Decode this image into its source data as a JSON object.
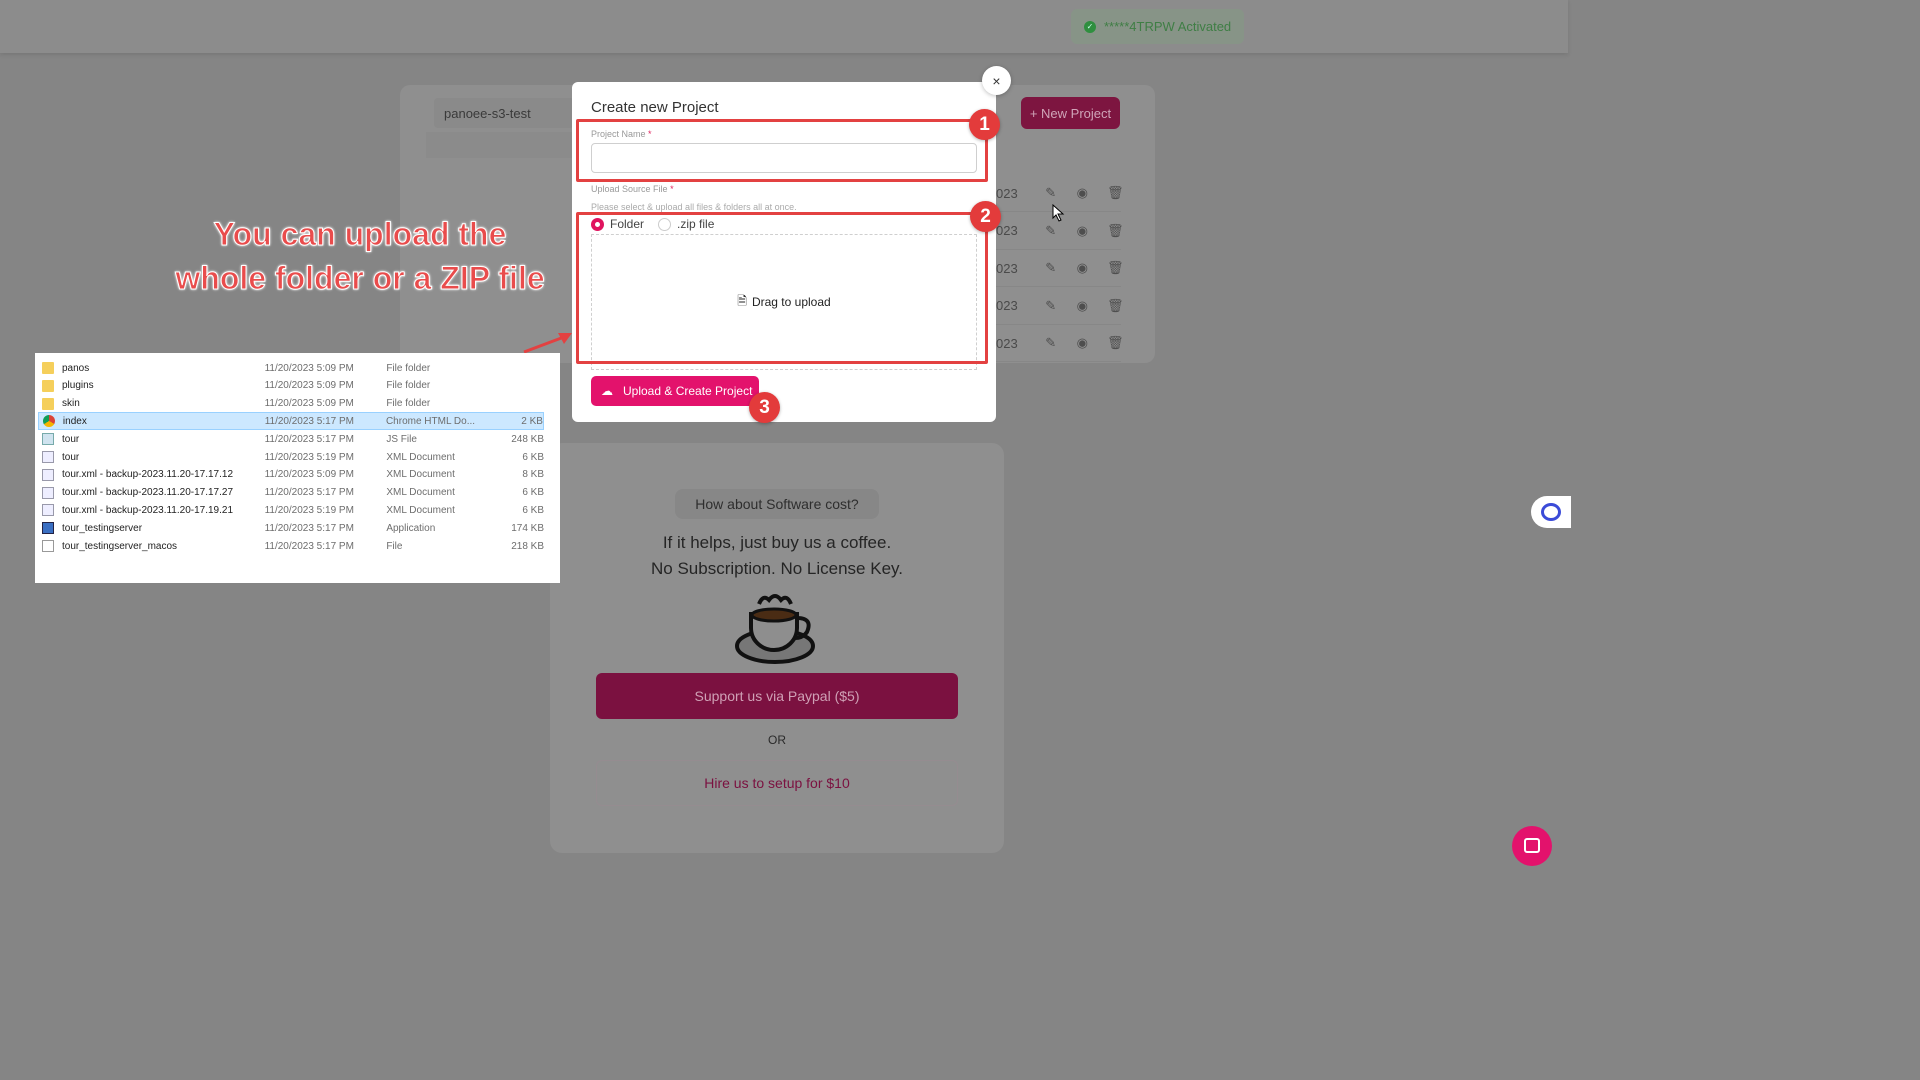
{
  "header": {
    "license_badge": "*****4TRPW Activated"
  },
  "background": {
    "project_name": "panoee-s3-test",
    "new_project_label": "+ New Project",
    "rows": [
      {
        "date": "023"
      },
      {
        "date": "023"
      },
      {
        "date": "023"
      },
      {
        "date": "023"
      },
      {
        "date": "023"
      }
    ]
  },
  "pricing": {
    "question": "How about Software cost?",
    "line1": "If it helps, just buy us a coffee.",
    "line2": "No Subscription. No License Key.",
    "paypal_label": "Support us via Paypal ($5)",
    "or": "OR",
    "hire_label": "Hire us to setup for $10"
  },
  "annotation": {
    "caption_line1": "You can upload the",
    "caption_line2": "whole folder or a ZIP file",
    "steps": [
      "1",
      "2",
      "3"
    ],
    "color": "#e34141"
  },
  "explorer": {
    "files": [
      {
        "name": "panos",
        "date": "11/20/2023 5:09 PM",
        "type": "File folder",
        "size": "",
        "icon": "folder"
      },
      {
        "name": "plugins",
        "date": "11/20/2023 5:09 PM",
        "type": "File folder",
        "size": "",
        "icon": "folder"
      },
      {
        "name": "skin",
        "date": "11/20/2023 5:09 PM",
        "type": "File folder",
        "size": "",
        "icon": "folder"
      },
      {
        "name": "index",
        "date": "11/20/2023 5:17 PM",
        "type": "Chrome HTML Do...",
        "size": "2 KB",
        "icon": "chrome",
        "selected": true
      },
      {
        "name": "tour",
        "date": "11/20/2023 5:17 PM",
        "type": "JS File",
        "size": "248 KB",
        "icon": "js"
      },
      {
        "name": "tour",
        "date": "11/20/2023 5:19 PM",
        "type": "XML Document",
        "size": "6 KB",
        "icon": "xml"
      },
      {
        "name": "tour.xml - backup-2023.11.20-17.17.12",
        "date": "11/20/2023 5:09 PM",
        "type": "XML Document",
        "size": "8 KB",
        "icon": "xml"
      },
      {
        "name": "tour.xml - backup-2023.11.20-17.17.27",
        "date": "11/20/2023 5:17 PM",
        "type": "XML Document",
        "size": "6 KB",
        "icon": "xml"
      },
      {
        "name": "tour.xml - backup-2023.11.20-17.19.21",
        "date": "11/20/2023 5:19 PM",
        "type": "XML Document",
        "size": "6 KB",
        "icon": "xml"
      },
      {
        "name": "tour_testingserver",
        "date": "11/20/2023 5:17 PM",
        "type": "Application",
        "size": "174 KB",
        "icon": "app"
      },
      {
        "name": "tour_testingserver_macos",
        "date": "11/20/2023 5:17 PM",
        "type": "File",
        "size": "218 KB",
        "icon": "file"
      }
    ]
  },
  "modal": {
    "title": "Create new Project",
    "close": "×",
    "project_name_label": "Project Name",
    "project_name_value": "",
    "required": "*",
    "upload_label": "Upload Source File",
    "upload_hint": "Please select & upload all files & folders all at once.",
    "options": [
      "Folder",
      ".zip file"
    ],
    "selected_option": "Folder",
    "drop_text": "Drag to upload",
    "submit_label": "Upload & Create Project",
    "accent": "#e3126c"
  }
}
